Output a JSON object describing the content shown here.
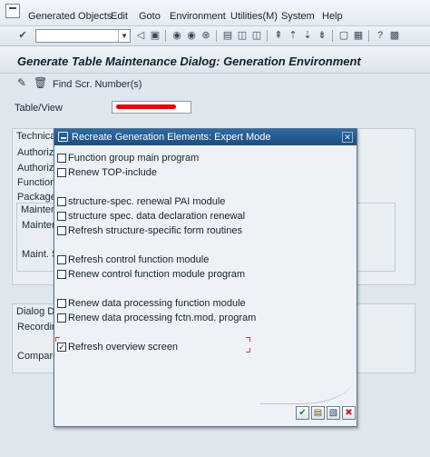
{
  "menu": {
    "items": [
      "Generated Objects",
      "Edit",
      "Goto",
      "Environment",
      "Utilities(M)",
      "System",
      "Help"
    ]
  },
  "toolbar": {
    "command_value": ""
  },
  "page": {
    "title": "Generate Table Maintenance Dialog: Generation Environment",
    "find_button": "Find Scr. Number(s)"
  },
  "background": {
    "labels": [
      "Table/View",
      "Technical",
      "Authoriz",
      "Authoriz",
      "Function",
      "Package",
      "Maintena",
      "Maintena",
      "Maint. Sc",
      "Dialog Dat",
      "Recording",
      "Compare"
    ]
  },
  "dialog": {
    "title": "Recreate Generation Elements: Expert Mode",
    "options": [
      {
        "label": "Function group main program",
        "checked": false
      },
      {
        "label": "Renew TOP-include",
        "checked": false
      },
      {
        "label": "structure-spec. renewal PAI module",
        "checked": false
      },
      {
        "label": "structure spec. data declaration renewal",
        "checked": false
      },
      {
        "label": "Refresh structure-specific form routines",
        "checked": false
      },
      {
        "label": "Refresh control function module",
        "checked": false
      },
      {
        "label": "Renew control function module program",
        "checked": false
      },
      {
        "label": "Renew data processing function module",
        "checked": false
      },
      {
        "label": "Renew data processing fctn.mod. program",
        "checked": false
      },
      {
        "label": "Refresh overview screen",
        "checked": true
      }
    ]
  },
  "colors": {
    "accent": "#1f4f80",
    "confirm": "#1d8a1d",
    "cancel": "#c81e1e"
  },
  "icons": [
    "check-icon",
    "save-list-icon",
    "print-icon",
    "cancel-icon"
  ]
}
